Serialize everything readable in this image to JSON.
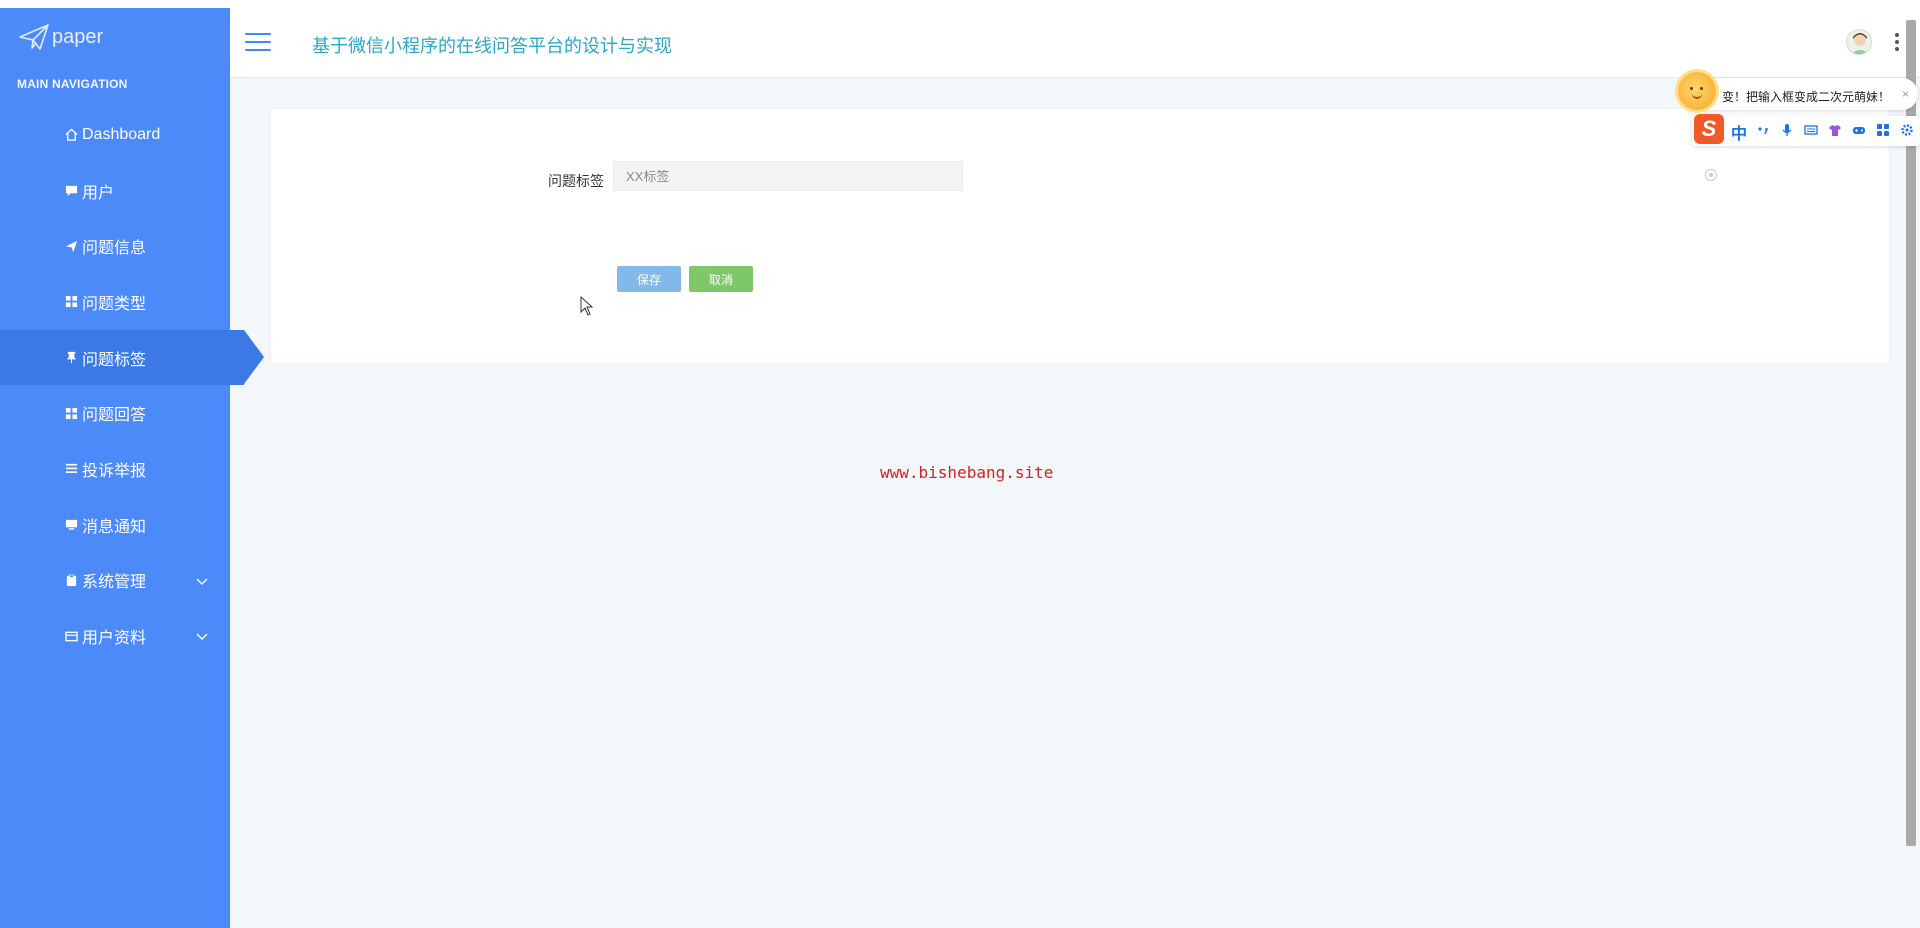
{
  "sidebar": {
    "logo_text": "paper",
    "nav_title": "MAIN NAVIGATION",
    "items": [
      {
        "label": "Dashboard"
      },
      {
        "label": "用户"
      },
      {
        "label": "问题信息"
      },
      {
        "label": "问题类型"
      },
      {
        "label": "问题标签"
      },
      {
        "label": "问题回答"
      },
      {
        "label": "投诉举报"
      },
      {
        "label": "消息通知"
      },
      {
        "label": "系统管理"
      },
      {
        "label": "用户资料"
      }
    ]
  },
  "header": {
    "title": "基于微信小程序的在线问答平台的设计与实现"
  },
  "form": {
    "label": "问题标签",
    "value": "",
    "placeholder": "XX标签",
    "save_label": "保存",
    "cancel_label": "取消"
  },
  "watermark": "www.bishebang.site",
  "ime": {
    "tip": "变！把输入框变成二次元萌妹！",
    "close": "×",
    "logo": "S",
    "mode": "中"
  },
  "colors": {
    "sidebar": "#4b8af8",
    "active": "#3b79e4",
    "title": "#2aa7c9",
    "save": "#82b9ea",
    "cancel": "#7ec86a",
    "watermark": "#d0231f"
  }
}
